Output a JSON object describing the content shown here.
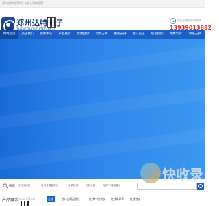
{
  "topbar": {
    "welcome": "郑州达特电子科技有限公司欢迎您！"
  },
  "logo": {
    "cn_name": "郑州达特电子",
    "en_name": "ZHENGZHOUDATEDIANZI",
    "emblem_icon": "company-emblem-icon",
    "qr_code": "qr-code"
  },
  "hotline": {
    "label": "产品全热线咨询热线",
    "number": "13939013882",
    "icon": "phone-icon"
  },
  "nav": {
    "items": [
      {
        "label": "网站首页",
        "active": true
      },
      {
        "label": "关于我们",
        "active": false
      },
      {
        "label": "新闻中心",
        "active": false
      },
      {
        "label": "产品展示",
        "active": false
      },
      {
        "label": "优秀品牌",
        "active": false
      },
      {
        "label": "付款方式",
        "active": false
      },
      {
        "label": "服务支持",
        "active": false
      },
      {
        "label": "客户见证",
        "active": false
      },
      {
        "label": "联系我们",
        "active": false
      },
      {
        "label": "优秀案例",
        "active": false
      },
      {
        "label": "联系方式",
        "active": false
      }
    ]
  },
  "search": {
    "label": "搜索",
    "tags": [
      "分析仪在线",
      "进口金属监测仪",
      "水质检测",
      "在线水质",
      "在线PH值测量仪"
    ],
    "placeholder": "",
    "button_icon": "search-icon"
  },
  "products": {
    "title": "产品展示",
    "title_en": "Product Show",
    "tabs": [
      {
        "label": "全部",
        "active": true
      },
      {
        "label": "进口金属监测仪",
        "active": false
      },
      {
        "label": "在线PH分析仪",
        "active": false
      },
      {
        "label": "在线电导率",
        "active": false
      },
      {
        "label": "在线浊度",
        "active": false
      }
    ]
  },
  "watermark": {
    "text": "快收录"
  },
  "colors": {
    "nav_blue": "#1b60c7",
    "banner_blue": "#2f86e8",
    "brand_navy": "#1a3f91",
    "hotline_red": "#d32f2f"
  }
}
